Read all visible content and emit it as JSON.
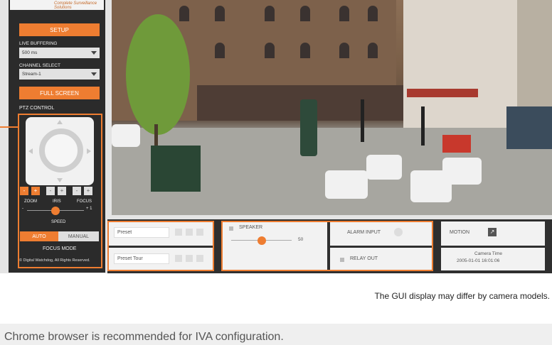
{
  "sidebar": {
    "brand_tagline": "Complete Surveillance Solutions",
    "setup_label": "SETUP",
    "live_buffering_label": "LIVE BUFFERING",
    "live_buffering_value": "500 ms",
    "channel_select_label": "CHANNEL SELECT",
    "channel_select_value": "Stream-1",
    "fullscreen_label": "FULL SCREEN",
    "ptz_label": "PTZ CONTROL",
    "zoom_minus": "-",
    "zoom_plus": "+",
    "iris_minus": "-",
    "iris_plus": "+",
    "focus_minus": "-",
    "focus_plus": "+",
    "zoom_label": "ZOOM",
    "iris_label": "IRIS",
    "focus_label": "FOCUS",
    "speed_min": "-",
    "speed_max": "+ 1",
    "speed_label": "SPEED",
    "auto_label": "AUTO",
    "manual_label": "MANUAL",
    "focus_mode_label": "FOCUS MODE",
    "copyright": "© Digital Watchdog, All Rights Reserved."
  },
  "bottom_panel": {
    "preset_placeholder": "Preset",
    "preset_tour_placeholder": "Preset Tour",
    "speaker_label": "SPEAKER",
    "speaker_value": "50",
    "alarm_input_label": "ALARM INPUT",
    "relay_out_label": "RELAY OUT",
    "motion_label": "MOTION",
    "camera_time_label": "Camera Time",
    "camera_time_value": "2005-01-01 16:01:06"
  },
  "caption": "The GUI display may differ by camera models.",
  "banner": "Chrome browser is recommended for IVA configuration.",
  "colors": {
    "accent": "#ee7d31",
    "sidebar_bg": "#2b2b2b",
    "panel_bg": "#2f2f2f"
  }
}
